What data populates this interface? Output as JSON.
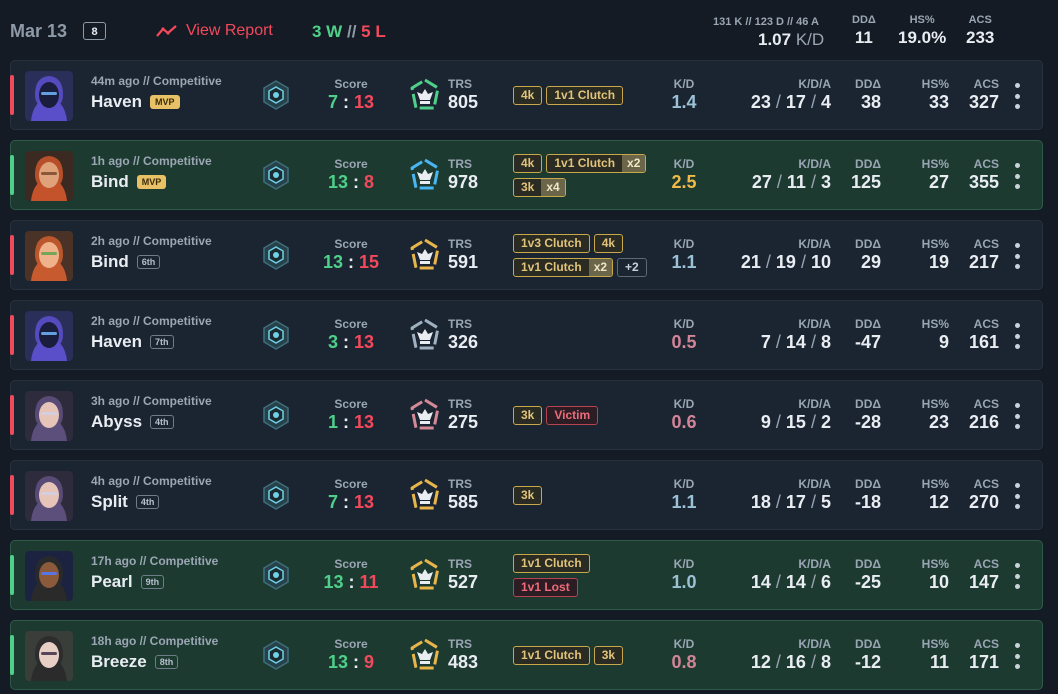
{
  "header": {
    "date": "Mar 13",
    "match_count": "8",
    "view_report": "View Report",
    "wins": "3 W",
    "wl_sep": "//",
    "losses": "5 L",
    "totals": "131 K // 123 D // 46 A",
    "kd_value": "1.07",
    "kd_unit": "K/D",
    "dda_label": "DDΔ",
    "dda_value": "11",
    "hs_label": "HS%",
    "hs_value": "19.0%",
    "acs_label": "ACS",
    "acs_value": "233"
  },
  "labels": {
    "score": "Score",
    "trs": "TRS",
    "kd": "K/D",
    "kda": "K/D/A",
    "dda": "DDΔ",
    "hs": "HS%",
    "acs": "ACS",
    "score_sep": ":",
    "kda_sep": "/"
  },
  "colors": {
    "win": "#4fd08a",
    "loss": "#f2495c",
    "kd_gold": "#f0bb4a",
    "kd_blue": "#9bc1d4",
    "kd_red": "#d28597"
  },
  "matches": [
    {
      "result": "loss",
      "agent_icon": "omen-avatar",
      "meta": "44m ago // Competitive",
      "map": "Haven",
      "badge": "MVP",
      "badge_type": "mvp",
      "trs_icon": "trs-green-icon",
      "trs": "805",
      "score_a": "7",
      "score_b": "13",
      "tags": [
        [
          {
            "t": "4k"
          },
          {
            "t": "1v1 Clutch"
          }
        ]
      ],
      "kd": "1.4",
      "kd_color": "#9bc1d4",
      "k": "23",
      "d": "17",
      "a": "4",
      "dda": "38",
      "hs": "33",
      "acs": "327"
    },
    {
      "result": "win",
      "agent_icon": "brimstone-avatar",
      "meta": "1h ago // Competitive",
      "map": "Bind",
      "badge": "MVP",
      "badge_type": "mvp",
      "trs_icon": "trs-blue-icon",
      "trs": "978",
      "score_a": "13",
      "score_b": "8",
      "tags": [
        [
          {
            "t": "4k"
          },
          {
            "t": "1v1 Clutch",
            "m": "x2"
          }
        ],
        [
          {
            "t": "3k",
            "m": "x4"
          }
        ]
      ],
      "kd": "2.5",
      "kd_color": "#f0bb4a",
      "k": "27",
      "d": "11",
      "a": "3",
      "dda": "125",
      "hs": "27",
      "acs": "355"
    },
    {
      "result": "loss",
      "agent_icon": "skye-avatar",
      "meta": "2h ago // Competitive",
      "map": "Bind",
      "badge": "6th",
      "badge_type": "place",
      "trs_icon": "trs-gold-icon",
      "trs": "591",
      "score_a": "13",
      "score_b": "15",
      "tags": [
        [
          {
            "t": "1v3 Clutch"
          },
          {
            "t": "4k"
          }
        ],
        [
          {
            "t": "1v1 Clutch",
            "m": "x2"
          },
          {
            "t": "+2",
            "c": "plus"
          }
        ]
      ],
      "kd": "1.1",
      "kd_color": "#9bc1d4",
      "k": "21",
      "d": "19",
      "a": "10",
      "dda": "29",
      "hs": "19",
      "acs": "217"
    },
    {
      "result": "loss",
      "agent_icon": "omen-avatar",
      "meta": "2h ago // Competitive",
      "map": "Haven",
      "badge": "7th",
      "badge_type": "place",
      "trs_icon": "trs-silver-icon",
      "trs": "326",
      "score_a": "3",
      "score_b": "13",
      "tags": [],
      "kd": "0.5",
      "kd_color": "#d28597",
      "k": "7",
      "d": "14",
      "a": "8",
      "dda": "-47",
      "hs": "9",
      "acs": "161"
    },
    {
      "result": "loss",
      "agent_icon": "vyse-avatar",
      "meta": "3h ago // Competitive",
      "map": "Abyss",
      "badge": "4th",
      "badge_type": "place",
      "trs_icon": "trs-red-icon",
      "trs": "275",
      "score_a": "1",
      "score_b": "13",
      "tags": [
        [
          {
            "t": "3k"
          },
          {
            "t": "Victim",
            "c": "red"
          }
        ]
      ],
      "kd": "0.6",
      "kd_color": "#d28597",
      "k": "9",
      "d": "15",
      "a": "2",
      "dda": "-28",
      "hs": "23",
      "acs": "216"
    },
    {
      "result": "loss",
      "agent_icon": "vyse-avatar",
      "meta": "4h ago // Competitive",
      "map": "Split",
      "badge": "4th",
      "badge_type": "place",
      "trs_icon": "trs-gold-icon",
      "trs": "585",
      "score_a": "7",
      "score_b": "13",
      "tags": [
        [
          {
            "t": "3k"
          }
        ]
      ],
      "kd": "1.1",
      "kd_color": "#9bc1d4",
      "k": "18",
      "d": "17",
      "a": "5",
      "dda": "-18",
      "hs": "12",
      "acs": "270"
    },
    {
      "result": "win",
      "agent_icon": "neon-avatar",
      "meta": "17h ago // Competitive",
      "map": "Pearl",
      "badge": "9th",
      "badge_type": "place",
      "trs_icon": "trs-gold-icon",
      "trs": "527",
      "score_a": "13",
      "score_b": "11",
      "tags": [
        [
          {
            "t": "1v1 Clutch"
          }
        ],
        [
          {
            "t": "1v1 Lost",
            "c": "red"
          }
        ]
      ],
      "kd": "1.0",
      "kd_color": "#9bc1d4",
      "k": "14",
      "d": "14",
      "a": "6",
      "dda": "-25",
      "hs": "10",
      "acs": "147"
    },
    {
      "result": "win",
      "agent_icon": "viper-avatar",
      "meta": "18h ago // Competitive",
      "map": "Breeze",
      "badge": "8th",
      "badge_type": "place",
      "trs_icon": "trs-gold-icon",
      "trs": "483",
      "score_a": "13",
      "score_b": "9",
      "tags": [
        [
          {
            "t": "1v1 Clutch"
          },
          {
            "t": "3k"
          }
        ]
      ],
      "kd": "0.8",
      "kd_color": "#d28597",
      "k": "12",
      "d": "16",
      "a": "8",
      "dda": "-12",
      "hs": "11",
      "acs": "171"
    }
  ]
}
